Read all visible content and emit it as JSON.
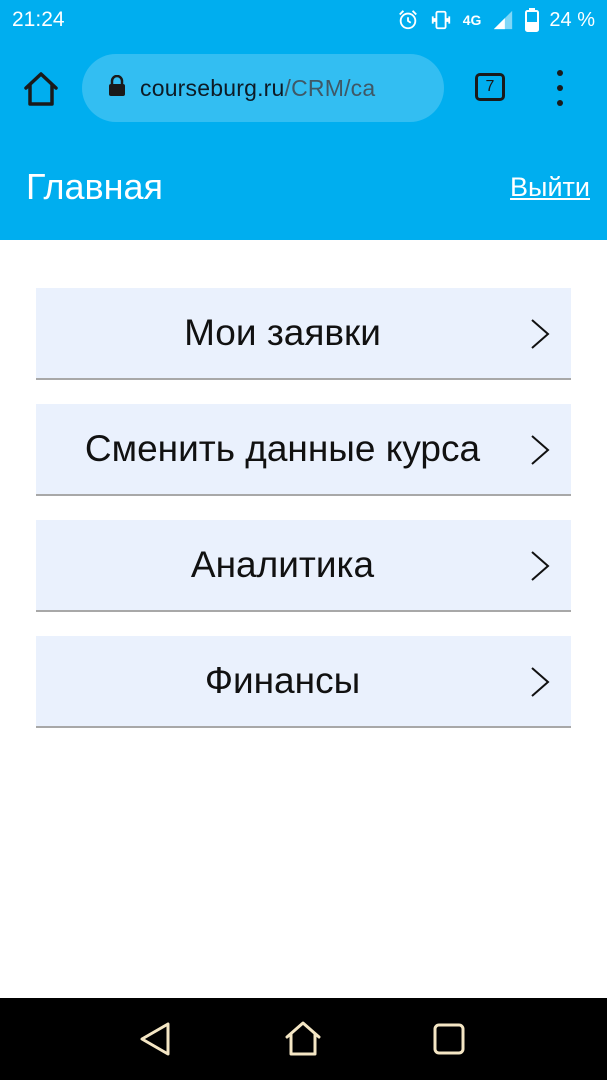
{
  "status_bar": {
    "time": "21:24",
    "network": "4G",
    "battery": "24 %",
    "icons": [
      "alarm-icon",
      "vibrate-icon",
      "signal-icon",
      "battery-icon"
    ]
  },
  "browser": {
    "url_domain": "courseburg.ru",
    "url_path": "/CRM/ca",
    "tab_count": "7",
    "icons": [
      "home-icon",
      "lock-icon",
      "tabs-icon",
      "more-vert-icon"
    ]
  },
  "header": {
    "title": "Главная",
    "logout_label": "Выйти"
  },
  "menu": {
    "items": [
      {
        "label": "Мои заявки"
      },
      {
        "label": "Сменить данные курса"
      },
      {
        "label": "Аналитика"
      },
      {
        "label": "Финансы"
      }
    ]
  },
  "nav_bar": {
    "icons": [
      "back-icon",
      "home-icon",
      "recents-icon"
    ]
  },
  "colors": {
    "accent": "#00aeef",
    "menu_item_bg": "#eaf1fd",
    "menu_item_border": "#a8a8a8"
  }
}
